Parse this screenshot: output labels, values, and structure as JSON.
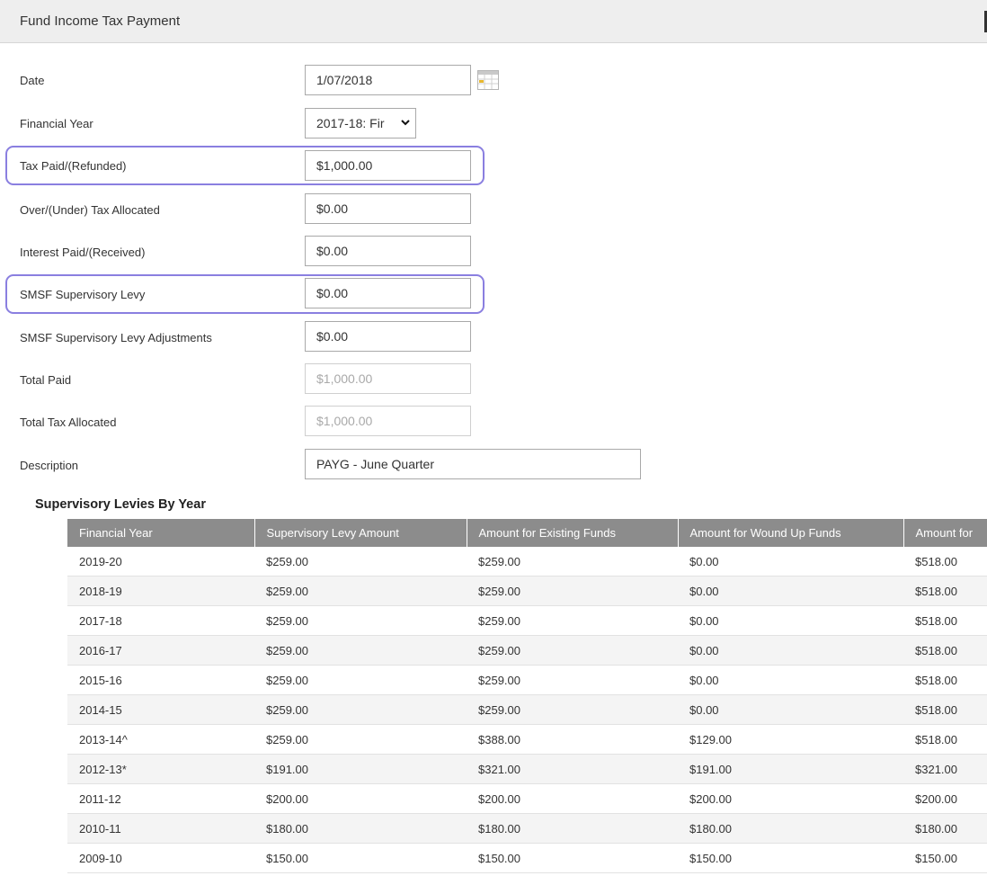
{
  "header": {
    "title": "Fund Income Tax Payment"
  },
  "form": {
    "date": {
      "label": "Date",
      "value": "1/07/2018"
    },
    "financial_year": {
      "label": "Financial Year",
      "selected": "2017-18: Fir"
    },
    "tax_paid": {
      "label": "Tax Paid/(Refunded)",
      "value": "$1,000.00"
    },
    "over_under_tax": {
      "label": "Over/(Under) Tax Allocated",
      "value": "$0.00"
    },
    "interest_paid": {
      "label": "Interest Paid/(Received)",
      "value": "$0.00"
    },
    "smsf_levy": {
      "label": "SMSF Supervisory Levy",
      "value": "$0.00"
    },
    "smsf_levy_adj": {
      "label": "SMSF Supervisory Levy Adjustments",
      "value": "$0.00"
    },
    "total_paid": {
      "label": "Total Paid",
      "value": "$1,000.00"
    },
    "total_tax_allocated": {
      "label": "Total Tax Allocated",
      "value": "$1,000.00"
    },
    "description": {
      "label": "Description",
      "value": "PAYG - June Quarter"
    }
  },
  "levies": {
    "title": "Supervisory Levies By Year",
    "columns": [
      "Financial Year",
      "Supervisory Levy Amount",
      "Amount for Existing Funds",
      "Amount for Wound Up Funds",
      "Amount for"
    ],
    "rows": [
      [
        "2019-20",
        "$259.00",
        "$259.00",
        "$0.00",
        "$518.00"
      ],
      [
        "2018-19",
        "$259.00",
        "$259.00",
        "$0.00",
        "$518.00"
      ],
      [
        "2017-18",
        "$259.00",
        "$259.00",
        "$0.00",
        "$518.00"
      ],
      [
        "2016-17",
        "$259.00",
        "$259.00",
        "$0.00",
        "$518.00"
      ],
      [
        "2015-16",
        "$259.00",
        "$259.00",
        "$0.00",
        "$518.00"
      ],
      [
        "2014-15",
        "$259.00",
        "$259.00",
        "$0.00",
        "$518.00"
      ],
      [
        "2013-14^",
        "$259.00",
        "$388.00",
        "$129.00",
        "$518.00"
      ],
      [
        "2012-13*",
        "$191.00",
        "$321.00",
        "$191.00",
        "$321.00"
      ],
      [
        "2011-12",
        "$200.00",
        "$200.00",
        "$200.00",
        "$200.00"
      ],
      [
        "2010-11",
        "$180.00",
        "$180.00",
        "$180.00",
        "$180.00"
      ],
      [
        "2009-10",
        "$150.00",
        "$150.00",
        "$150.00",
        "$150.00"
      ]
    ]
  },
  "colors": {
    "highlight": "#8a7fe0",
    "table_header": "#8c8c8c",
    "header_bg": "#eeeeee"
  }
}
